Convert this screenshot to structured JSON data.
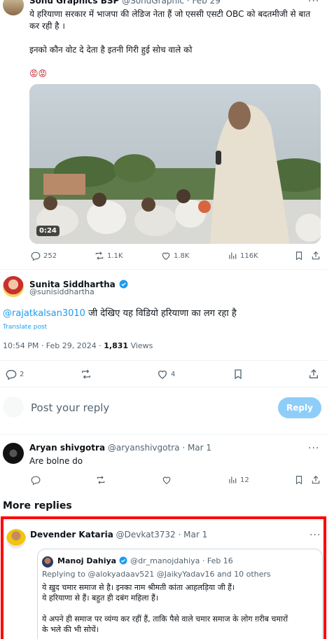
{
  "tweet1": {
    "name": "Sonu Graphics BSP",
    "handle": "@SonuGraphic",
    "date": "Feb 29",
    "text_line1": "ये हरियाणा सरकार में भाजपा की लेडिज नेता हैं जो एससी एसटी OBC को बदतमीजी से बात",
    "text_line2": "कर रही है ।",
    "text_line3": "इनको कौन वोट दे देता है इतनी गिरी हुई सोच वाले को",
    "emojis": "😡😡",
    "video_duration": "0:24",
    "replies": "252",
    "reposts": "1.1K",
    "likes": "1.8K",
    "views": "116K"
  },
  "tweet2": {
    "name": "Sunita Siddhartha",
    "handle": "@sunisiddhartha",
    "mention": "@rajatkalsan3010",
    "text": " जी देखिए यह विडियो हरियाणा का लग रहा है",
    "translate": "Translate post",
    "time": "10:54 PM · Feb 29, 2024 · ",
    "views_count": "1,831",
    "views_label": "Views",
    "replies": "2",
    "likes": "4"
  },
  "compose": {
    "placeholder": "Post your reply",
    "button": "Reply"
  },
  "tweet3": {
    "name": "Aryan shivgotra",
    "handle": "@aryanshivgotra",
    "date": "· Mar 1",
    "text": "Are bolne do",
    "views": "12"
  },
  "more_replies": "More replies",
  "tweet4": {
    "name": "Devender Kataria",
    "handle": "@Devkat3732",
    "date": "· Mar 1",
    "quote": {
      "name": "Manoj Dahiya",
      "handle": "@dr_manojdahiya",
      "date": "· Feb 16",
      "replying_prefix": "Replying to ",
      "replying_users": "@alokyadaav521 @JaikyYadav16 and 10 others",
      "line1": "ये ख़ुद चमार समाज से है। इनका नाम श्रीमती कांता आहलड़िया जी हैं।",
      "line2": "ये हरियाणा से हैं। बहुत ही दबंग महिला हैं।",
      "line3": "ये अपने ही समाज पर व्यंग्य कर रहीं हैं, ताकि पैसे वाले चमार समाज के लोग ग़रीब चमारों",
      "line4": "के भले की भी सोचें।"
    }
  },
  "colors": {
    "accent": "#1d9bf0",
    "highlight_border": "#ff0000",
    "muted": "#536471"
  }
}
